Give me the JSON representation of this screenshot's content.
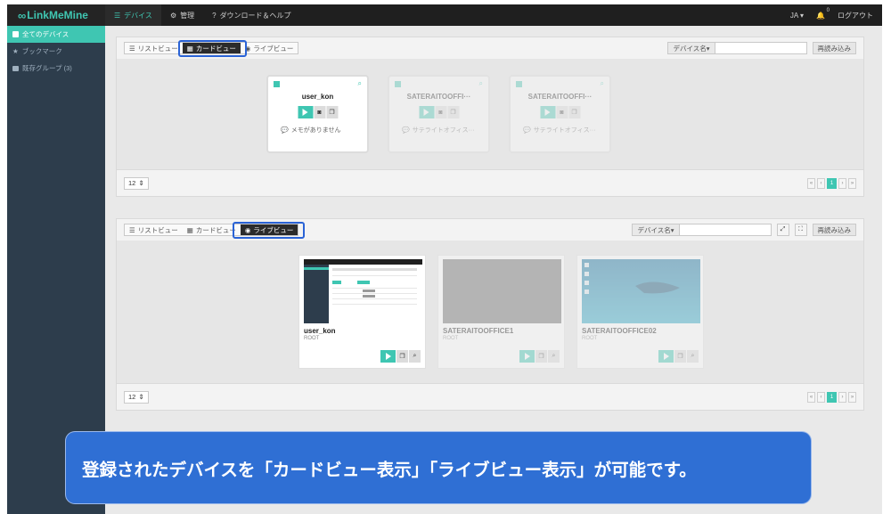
{
  "brand": "LinkMeMine",
  "nav": {
    "devices": "デバイス",
    "admin": "管理",
    "download": "ダウンロード＆ヘルプ",
    "lang": "JA",
    "notif_count": "0",
    "logout": "ログアウト"
  },
  "sidebar": {
    "items": [
      {
        "label": "全てのデバイス"
      },
      {
        "label": "ブックマーク"
      },
      {
        "label": "既存グループ (3)"
      }
    ]
  },
  "panel1": {
    "tabs": {
      "list": "リストビュー",
      "card": "カードビュー",
      "live": "ライブビュー"
    },
    "select": "デバイス名",
    "reload": "再読み込み",
    "page_size": "12",
    "current_page": "1",
    "cards": [
      {
        "name": "user_kon",
        "status": "メモがありません"
      },
      {
        "name": "SATERAITOOFFI···",
        "status": "サテライトオフィス···"
      },
      {
        "name": "SATERAITOOFFI···",
        "status": "サテライトオフィス···"
      }
    ]
  },
  "panel2": {
    "tabs": {
      "list": "リストビュー",
      "card": "カードビュー",
      "live": "ライブビュー"
    },
    "select": "デバイス名",
    "reload": "再読み込み",
    "page_size": "12",
    "current_page": "1",
    "tiles": [
      {
        "name": "user_kon",
        "sub": "ROOT"
      },
      {
        "name": "SATERAITOOFFICE1",
        "sub": "ROOT"
      },
      {
        "name": "SATERAITOOFFICE02",
        "sub": "ROOT"
      }
    ]
  },
  "banner": "登録されたデバイスを「カードビュー表示」「ライブビュー表示」が可能です。",
  "colors": {
    "accent": "#3fc6b2",
    "highlight": "#2a63d6",
    "sidebar": "#2d3d4c",
    "banner": "#2f6fd4"
  }
}
